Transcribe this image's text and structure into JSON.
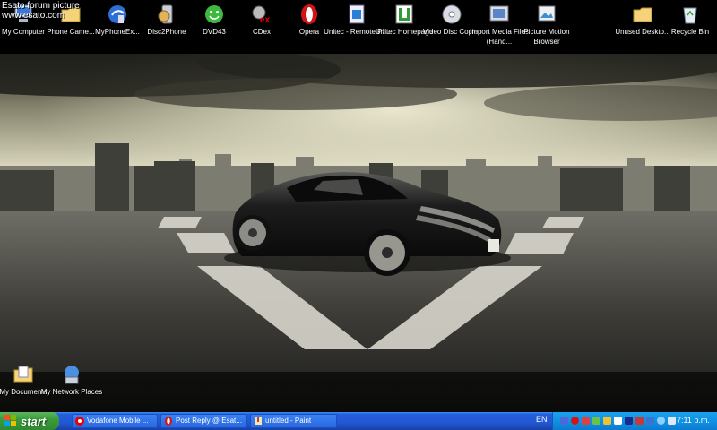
{
  "watermark": {
    "line1": "Esato forum picture",
    "line2": "www.esato.com"
  },
  "desktop": {
    "top_icons": [
      {
        "label": "My Computer"
      },
      {
        "label": "Phone Came..."
      },
      {
        "label": "MyPhoneEx..."
      },
      {
        "label": "Disc2Phone"
      },
      {
        "label": "DVD43"
      },
      {
        "label": "CDex"
      },
      {
        "label": "Opera"
      },
      {
        "label": "Unitec - Remote Pi..."
      },
      {
        "label": "Unitec Homepage"
      },
      {
        "label": "Video Disc Copier"
      },
      {
        "label": "Import Media Files (Hand..."
      },
      {
        "label": "Picture Motion Browser"
      },
      {
        "label": "Unused Deskto..."
      },
      {
        "label": "Recycle Bin"
      }
    ],
    "bottom_icons": [
      {
        "label": "My Documents"
      },
      {
        "label": "My Network Places"
      }
    ],
    "wallpaper": {
      "plate": "ES 530"
    }
  },
  "taskbar": {
    "start_label": "start",
    "tasks": [
      {
        "label": "Vodafone Mobile ..."
      },
      {
        "label": "Post Reply @ Esat..."
      },
      {
        "label": "untitled - Paint"
      }
    ],
    "language": "EN",
    "clock": "7:11 p.m.",
    "colors": {
      "bar": "#245edb",
      "start": "#3a9b3a",
      "tray": "#0f8de0"
    }
  }
}
